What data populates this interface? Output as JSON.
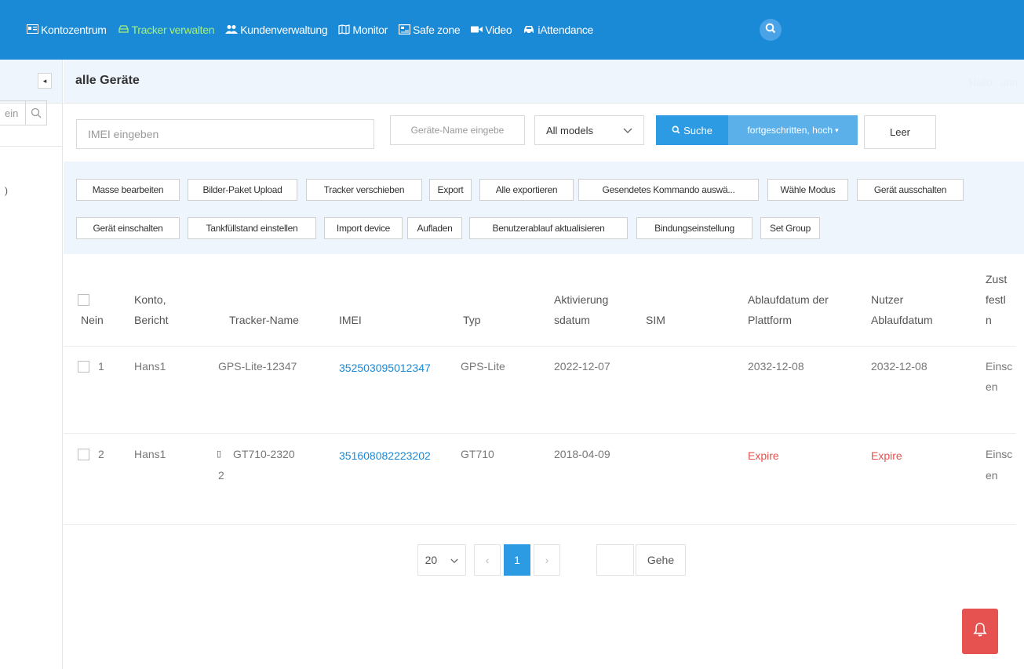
{
  "nav": {
    "items": [
      {
        "label": "Kontozentrum",
        "icon": "id-card-icon"
      },
      {
        "label": "Tracker verwalten",
        "icon": "car-outline-icon",
        "active": true
      },
      {
        "label": "Kundenverwaltung",
        "icon": "users-icon"
      },
      {
        "label": "Monitor",
        "icon": "map-icon"
      },
      {
        "label": "Safe zone",
        "icon": "geofence-icon"
      },
      {
        "label": "Video",
        "icon": "video-camera-icon"
      },
      {
        "label": "iAttendance",
        "icon": "car-icon"
      }
    ],
    "active_color": "#a6f07a",
    "bar_color": "#1a8ad6"
  },
  "sidebar": {
    "search_placeholder": "ein",
    "mark": ")"
  },
  "header": {
    "title": "alle Geräte",
    "greeting": "Hallo , ahn"
  },
  "filter": {
    "imei_placeholder": "IMEI eingeben",
    "name_placeholder": "Geräte-Name eingebe",
    "model_selected": "All models",
    "search_label": "Suche",
    "advanced_label": "fortgeschritten, hoch",
    "clear_label": "Leer"
  },
  "actions": [
    "Masse bearbeiten",
    "Bilder-Paket Upload",
    "Tracker verschieben",
    "Export",
    "Alle exportieren",
    "Gesendetes Kommando auswä...",
    "Wähle Modus",
    "Gerät ausschalten",
    "Gerät einschalten",
    "Tankfüllstand einstellen",
    "Import device",
    "Aufladen",
    "Benutzerablauf aktualisieren",
    "Bindungseinstellung",
    "Set Group"
  ],
  "table": {
    "headers": {
      "no_line": "Nein",
      "account_1": "Konto,",
      "account_2": "Bericht",
      "tracker_name": "Tracker-Name",
      "imei": "IMEI",
      "type": "Typ",
      "activation_1": "Aktivierung",
      "activation_2": "sdatum",
      "sim": "SIM",
      "platform_expiry_1": "Ablaufdatum der",
      "platform_expiry_2": "Plattform",
      "user_expiry_1": "Nutzer",
      "user_expiry_2": "Ablaufdatum",
      "state_1": "Zust",
      "state_2": "festl",
      "state_3": "n"
    },
    "rows": [
      {
        "no": "1",
        "account": "Hans1",
        "tracker_name_1": "GPS-Lite-12347",
        "tracker_name_2": "",
        "imei": "352503095012347",
        "type": "GPS-Lite",
        "activation": "2022-12-07",
        "sim": "",
        "platform_expiry": "2032-12-08",
        "user_expiry": "2032-12-08",
        "state_1": "Einsc",
        "state_2": "en"
      },
      {
        "no": "2",
        "account": "Hans1",
        "tracker_name_1": "GT710-2320",
        "tracker_name_2": "2",
        "imei": "351608082223202",
        "type": "GT710",
        "activation": "2018-04-09",
        "sim": "",
        "platform_expiry": "Expire",
        "user_expiry": "Expire",
        "state_1": "Einsc",
        "state_2": "en"
      }
    ]
  },
  "pagination": {
    "page_size": "20",
    "prev": "‹",
    "current_page": "1",
    "next": "›",
    "go_label": "Gehe"
  }
}
